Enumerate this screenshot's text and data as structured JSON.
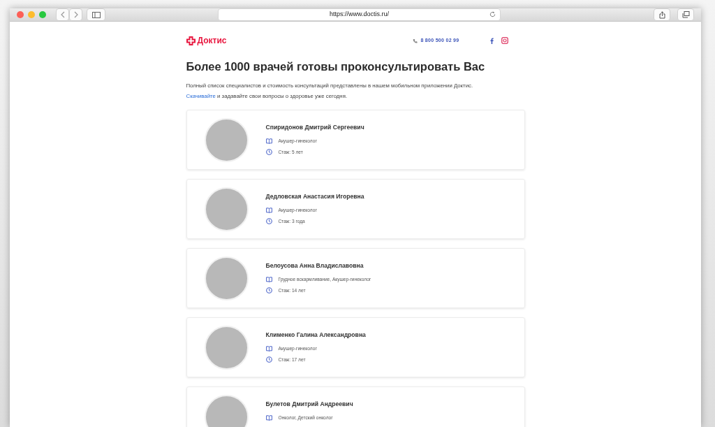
{
  "browser": {
    "url": "https://www.doctis.ru/"
  },
  "header": {
    "logo": "Доктис",
    "phone": "8 800 500 02 99"
  },
  "heading": "Более 1000 врачей готовы проконсультировать Вас",
  "intro": {
    "text": "Полный список специалистов и стоимость консультаций представлены в нашем мобильном приложении Доктис.",
    "link": "Скачивайте",
    "text_after": " и задавайте свои вопросы о здоровье уже сегодня."
  },
  "doctors": [
    {
      "name": "Спиридонов Дмитрий Сергеевич",
      "specialty": "Акушер-гинеколог",
      "experience": "Стаж: 5 лет"
    },
    {
      "name": "Дедловская Анастасия Игоревна",
      "specialty": "Акушер-гинеколог",
      "experience": "Стаж: 3 года"
    },
    {
      "name": "Белоусова Анна Владиславовна",
      "specialty": "Грудное вскармливание, Акушер-гинеколог",
      "experience": "Стаж: 14 лет"
    },
    {
      "name": "Клименко Галина Александровна",
      "specialty": "Акушер-гинеколог",
      "experience": "Стаж: 17 лет"
    },
    {
      "name": "Булетов Дмитрий Андреевич",
      "specialty": "Онколог, Детский онколог"
    }
  ]
}
